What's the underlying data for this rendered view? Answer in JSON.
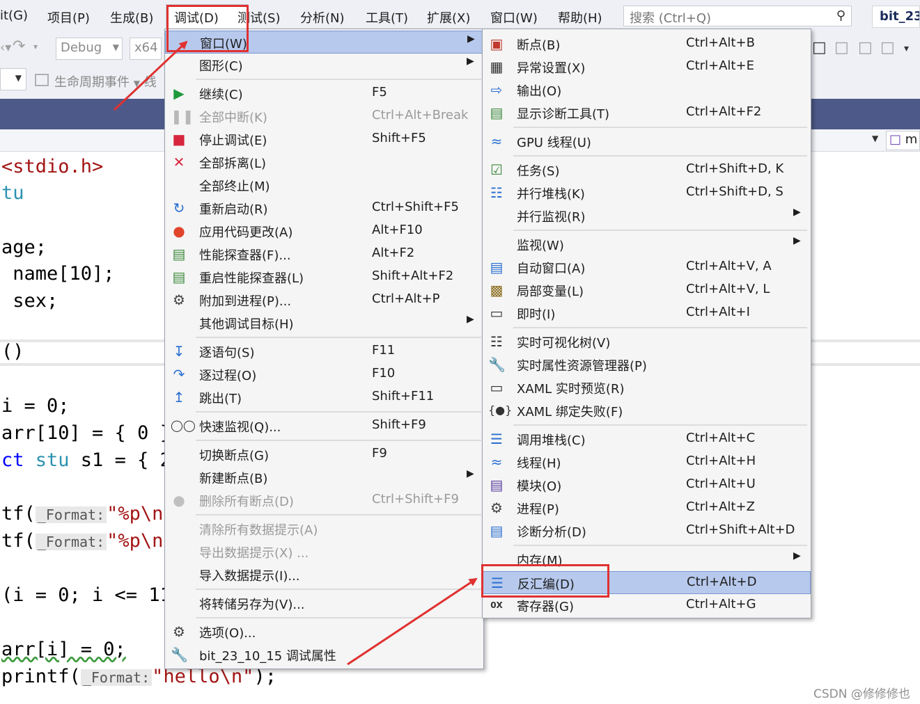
{
  "menubar": {
    "items": [
      "it(G)",
      "项目(P)",
      "生成(B)",
      "调试(D)",
      "测试(S)",
      "分析(N)",
      "工具(T)",
      "扩展(X)",
      "窗口(W)",
      "帮助(H)"
    ],
    "search_placeholder": "搜索 (Ctrl+Q)",
    "project_title": "bit_23"
  },
  "toolbar": {
    "config": "Debug",
    "platform": "x64",
    "lifecycle_label": "生命周期事件",
    "lifecycle_suffix": "线",
    "nav_right": "m"
  },
  "code_lines": {
    "l1_str": "<stdio.h>",
    "l2": "tu",
    "l3": "age;",
    "l4": " name[10];",
    "l5": " sex;",
    "l6": "()",
    "l7": "i = 0;",
    "l8": "arr[10] = { 0 }",
    "l9_kw": "ct",
    "l9_typ": " stu",
    "l9_rest": " s1 = { 2",
    "l10_a": "tf(",
    "l10_hint": "_Format:",
    "l10_str": "\"%p\\n",
    "l11_a": "tf(",
    "l11_hint": "_Format:",
    "l11_str": "\"%p\\n",
    "l12": "(i = 0; i <= 11",
    "l13": "arr[i] = 0;",
    "l14_a": "printf(",
    "l14_hint": "_Format:",
    "l14_str": "\"hello\\n\"",
    "l14_end": ");"
  },
  "debug_menu": {
    "items": [
      {
        "label": "窗口(W)",
        "shortcut": "",
        "icon": "window",
        "submenu": true,
        "highlighted": true
      },
      {
        "label": "图形(C)",
        "shortcut": "",
        "icon": "",
        "submenu": true
      },
      {
        "label": "继续(C)",
        "shortcut": "F5",
        "icon": "play-icon"
      },
      {
        "label": "全部中断(K)",
        "shortcut": "Ctrl+Alt+Break",
        "icon": "pause-icon",
        "disabled": true
      },
      {
        "label": "停止调试(E)",
        "shortcut": "Shift+F5",
        "icon": "stop-icon"
      },
      {
        "label": "全部拆离(L)",
        "shortcut": "",
        "icon": "detach-icon"
      },
      {
        "label": "全部终止(M)",
        "shortcut": "",
        "icon": ""
      },
      {
        "label": "重新启动(R)",
        "shortcut": "Ctrl+Shift+F5",
        "icon": "restart-icon"
      },
      {
        "label": "应用代码更改(A)",
        "shortcut": "Alt+F10",
        "icon": "hot-reload-icon"
      },
      {
        "label": "性能探查器(F)...",
        "shortcut": "Alt+F2",
        "icon": "profiler-icon"
      },
      {
        "label": "重启性能探查器(L)",
        "shortcut": "Shift+Alt+F2",
        "icon": "profiler-icon"
      },
      {
        "label": "附加到进程(P)...",
        "shortcut": "Ctrl+Alt+P",
        "icon": "gears-icon"
      },
      {
        "label": "其他调试目标(H)",
        "shortcut": "",
        "icon": "",
        "submenu": true
      },
      {
        "label": "逐语句(S)",
        "shortcut": "F11",
        "icon": "step-into-icon"
      },
      {
        "label": "逐过程(O)",
        "shortcut": "F10",
        "icon": "step-over-icon"
      },
      {
        "label": "跳出(T)",
        "shortcut": "Shift+F11",
        "icon": "step-out-icon"
      },
      {
        "label": "快速监视(Q)...",
        "shortcut": "Shift+F9",
        "icon": "glasses-icon"
      },
      {
        "label": "切换断点(G)",
        "shortcut": "F9",
        "icon": ""
      },
      {
        "label": "新建断点(B)",
        "shortcut": "",
        "icon": "",
        "submenu": true
      },
      {
        "label": "删除所有断点(D)",
        "shortcut": "Ctrl+Shift+F9",
        "icon": "delete-breakpoints-icon",
        "disabled": true
      },
      {
        "label": "清除所有数据提示(A)",
        "shortcut": "",
        "icon": "",
        "disabled": true
      },
      {
        "label": "导出数据提示(X) ...",
        "shortcut": "",
        "icon": "",
        "disabled": true
      },
      {
        "label": "导入数据提示(I)...",
        "shortcut": "",
        "icon": ""
      },
      {
        "label": "将转储另存为(V)...",
        "shortcut": "",
        "icon": ""
      },
      {
        "label": "选项(O)...",
        "shortcut": "",
        "icon": "gear-icon"
      },
      {
        "label": "bit_23_10_15 调试属性",
        "shortcut": "",
        "icon": "wrench-icon"
      }
    ]
  },
  "window_submenu": {
    "items": [
      {
        "label": "断点(B)",
        "shortcut": "Ctrl+Alt+B",
        "icon": "breakpoints-icon"
      },
      {
        "label": "异常设置(X)",
        "shortcut": "Ctrl+Alt+E",
        "icon": "exception-icon"
      },
      {
        "label": "输出(O)",
        "shortcut": "",
        "icon": "output-icon"
      },
      {
        "label": "显示诊断工具(T)",
        "shortcut": "Ctrl+Alt+F2",
        "icon": "diagnostics-icon"
      },
      {
        "label": "GPU 线程(U)",
        "shortcut": "",
        "icon": "gpu-threads-icon"
      },
      {
        "label": "任务(S)",
        "shortcut": "Ctrl+Shift+D, K",
        "icon": "tasks-icon"
      },
      {
        "label": "并行堆栈(K)",
        "shortcut": "Ctrl+Shift+D, S",
        "icon": "parallel-stacks-icon"
      },
      {
        "label": "并行监视(R)",
        "shortcut": "",
        "icon": "",
        "submenu": true
      },
      {
        "label": "监视(W)",
        "shortcut": "",
        "icon": "",
        "submenu": true
      },
      {
        "label": "自动窗口(A)",
        "shortcut": "Ctrl+Alt+V, A",
        "icon": "autos-icon"
      },
      {
        "label": "局部变量(L)",
        "shortcut": "Ctrl+Alt+V, L",
        "icon": "locals-icon"
      },
      {
        "label": "即时(I)",
        "shortcut": "Ctrl+Alt+I",
        "icon": "immediate-icon"
      },
      {
        "label": "实时可视化树(V)",
        "shortcut": "",
        "icon": "visual-tree-icon"
      },
      {
        "label": "实时属性资源管理器(P)",
        "shortcut": "",
        "icon": "property-explorer-icon"
      },
      {
        "label": "XAML 实时预览(R)",
        "shortcut": "",
        "icon": "xaml-preview-icon"
      },
      {
        "label": "XAML 绑定失败(F)",
        "shortcut": "",
        "icon": "xaml-binding-icon"
      },
      {
        "label": "调用堆栈(C)",
        "shortcut": "Ctrl+Alt+C",
        "icon": "call-stack-icon"
      },
      {
        "label": "线程(H)",
        "shortcut": "Ctrl+Alt+H",
        "icon": "threads-icon"
      },
      {
        "label": "模块(O)",
        "shortcut": "Ctrl+Alt+U",
        "icon": "modules-icon"
      },
      {
        "label": "进程(P)",
        "shortcut": "Ctrl+Alt+Z",
        "icon": "processes-icon"
      },
      {
        "label": "诊断分析(D)",
        "shortcut": "Ctrl+Shift+Alt+D",
        "icon": "diagnostic-analysis-icon"
      },
      {
        "label": "内存(M)",
        "shortcut": "",
        "icon": "",
        "submenu": true
      },
      {
        "label": "反汇编(D)",
        "shortcut": "Ctrl+Alt+D",
        "icon": "disassembly-icon",
        "highlighted": true
      },
      {
        "label": "寄存器(G)",
        "shortcut": "Ctrl+Alt+G",
        "icon": "registers-icon"
      }
    ]
  },
  "colors": {
    "annotation_red": "#e03131",
    "highlight": "#b7c9ec",
    "tabbar": "#4d5988"
  },
  "watermark": "CSDN @修修修也"
}
